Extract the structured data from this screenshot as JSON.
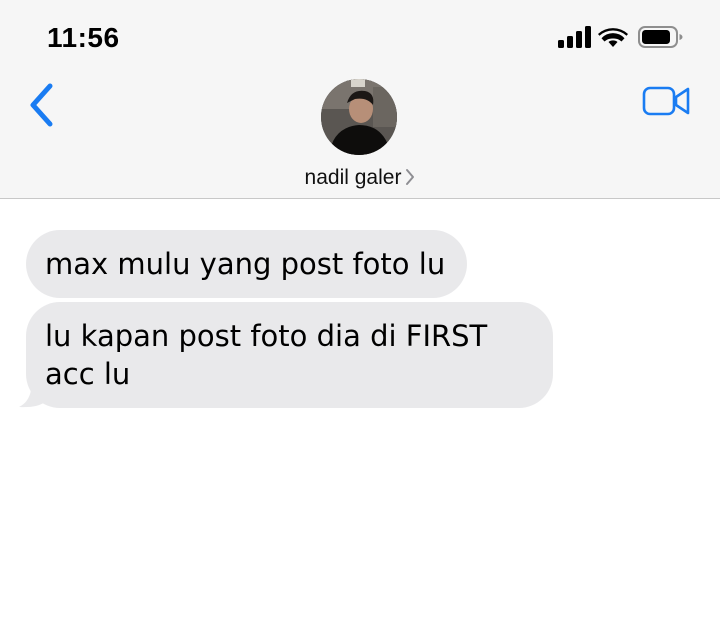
{
  "status_bar": {
    "time": "11:56",
    "icons": [
      "signal-icon",
      "wifi-icon",
      "battery-icon"
    ]
  },
  "header": {
    "back_icon": "chevron-left-icon",
    "contact_name": "nadil galer",
    "video_icon": "video-camera-icon",
    "accent_color": "#1a7cf2"
  },
  "messages": [
    {
      "direction": "incoming",
      "text": "max mulu yang post foto lu"
    },
    {
      "direction": "incoming",
      "text": "lu kapan post foto dia di FIRST acc lu"
    }
  ],
  "colors": {
    "incoming_bubble": "#e9e9eb",
    "header_background": "#f6f6f6"
  }
}
